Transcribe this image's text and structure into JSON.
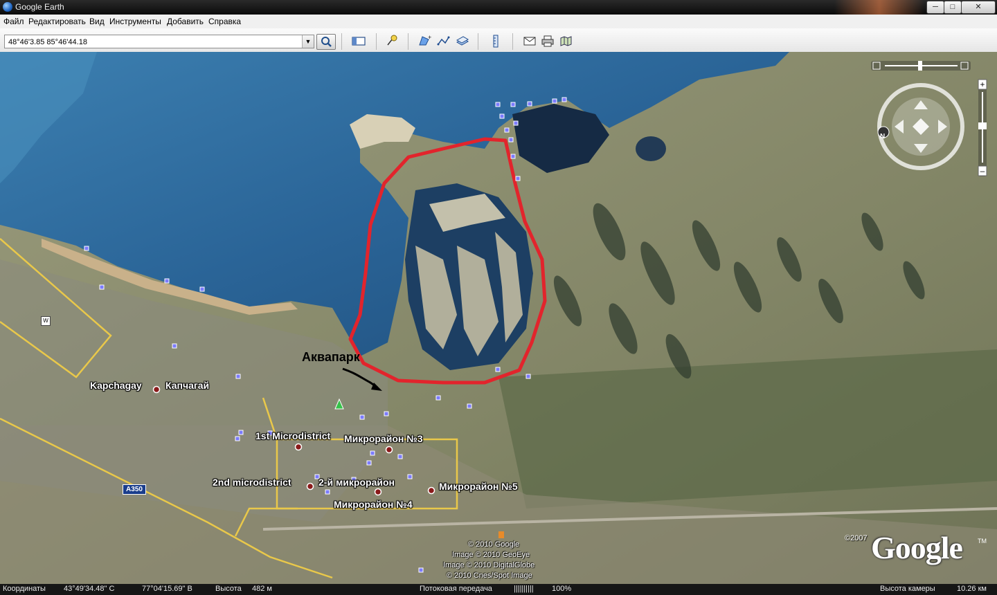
{
  "window": {
    "title": "Google Earth"
  },
  "menu": {
    "items": [
      "Файл",
      "Редактировать",
      "Вид",
      "Инструменты",
      "Добавить",
      "Справка"
    ]
  },
  "search": {
    "value": "48°46'3.85 85°46'44.18"
  },
  "map": {
    "annotation_label": "Аквапарк",
    "places": [
      {
        "label": "Kapchagay"
      },
      {
        "label": "Капчагай"
      },
      {
        "label": "1st Microdistrict"
      },
      {
        "label": "Микрорайон №3"
      },
      {
        "label": "2nd microdistrict"
      },
      {
        "label": "2-й микрорайон"
      },
      {
        "label": "Микрорайон №5"
      },
      {
        "label": "Микрорайон №4"
      }
    ],
    "road_label": "A350",
    "w_marker": "W",
    "credits": [
      "© 2010 Google",
      "Image © 2010 GeoEye",
      "Image © 2010 DigitalGlobe",
      "© 2010 Cnes/Spot Image"
    ],
    "copyright_2007": "©2007",
    "logo": "Google",
    "logo_tm": "TM",
    "compass_letter": "N"
  },
  "statusbar": {
    "coords_label": "Координаты",
    "lat": "43°49'34.48\" С",
    "lon": "77°04'15.69\" В",
    "alt_label": "Высота",
    "alt_value": "482 м",
    "stream_label": "Потоковая передача",
    "stream_bars": "||||||||||",
    "stream_value": "100%",
    "cam_label": "Высота камеры",
    "cam_value": "10.26 км"
  },
  "colors": {
    "loop": "#e2242c",
    "water": "#2c5f92",
    "land": "#8d8f70",
    "marker": "#7b7bff"
  }
}
